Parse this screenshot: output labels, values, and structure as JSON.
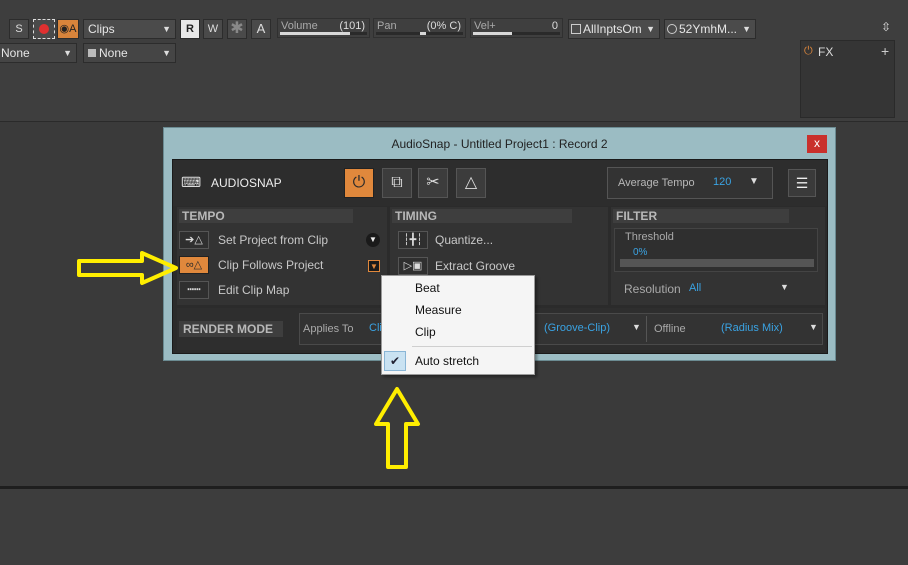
{
  "toolbar": {
    "solo_label": "S",
    "clips_select": "Clips",
    "read_label": "R",
    "write_label": "W",
    "a_label": "A",
    "volume_label": "Volume",
    "volume_value": "(101)",
    "volume_level": 0.8,
    "pan_label": "Pan",
    "pan_value": "(0% C)",
    "pan_level": 0.5,
    "vel_label": "Vel+",
    "vel_value": "0",
    "vel_level": 0.45,
    "input_select": "AllInptsOm",
    "output_select": "52YmhM...",
    "none_select_1": "None",
    "none_select_2": "None",
    "fx_label": "FX"
  },
  "dialog": {
    "title": "AudioSnap - Untitled Project1 : Record 2",
    "close_label": "x",
    "header_label": "AUDIOSNAP",
    "average_tempo_label": "Average Tempo",
    "average_tempo_value": "120",
    "tempo": {
      "heading": "TEMPO",
      "items": [
        "Set Project from Clip",
        "Clip Follows Project",
        "Edit Clip Map"
      ]
    },
    "timing": {
      "heading": "TIMING",
      "items": [
        "Quantize...",
        "Extract Groove"
      ]
    },
    "filter": {
      "heading": "FILTER",
      "threshold_label": "Threshold",
      "threshold_value": "0%",
      "resolution_label": "Resolution",
      "resolution_value": "All"
    },
    "render": {
      "heading": "RENDER MODE",
      "applies_to_label": "Applies To",
      "applies_to_value": "Cli",
      "groove_value": "(Groove-Clip)",
      "offline_label": "Offline",
      "radius_value": "(Radius Mix)"
    }
  },
  "menu": {
    "items": [
      "Beat",
      "Measure",
      "Clip"
    ],
    "auto_stretch": "Auto stretch"
  },
  "colors": {
    "accent_orange": "#e0883c",
    "link_blue": "#3aa3e3",
    "annotation_yellow": "#ffee00",
    "dialog_frame": "#9bbcc3"
  }
}
